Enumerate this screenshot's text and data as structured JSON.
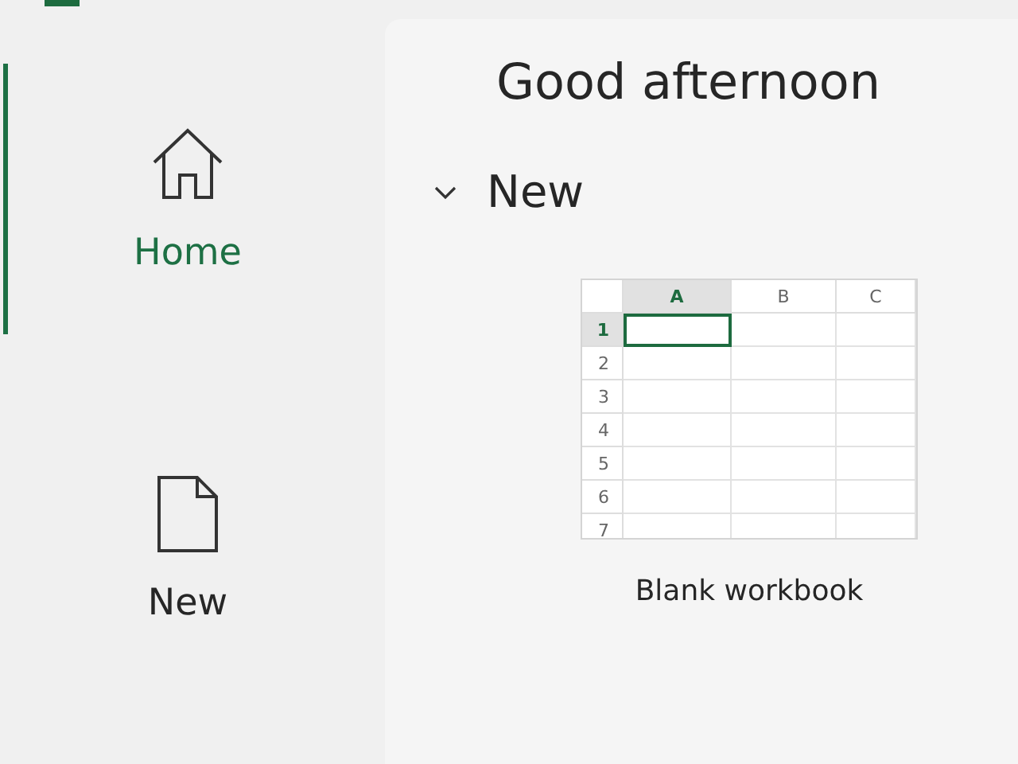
{
  "nav": [
    {
      "label": "Home",
      "kind": "home",
      "selected": true
    },
    {
      "label": "New",
      "kind": "new",
      "selected": false
    }
  ],
  "greeting": "Good afternoon",
  "section": {
    "title": "New",
    "expanded": true
  },
  "templates": [
    {
      "label": "Blank workbook",
      "columns": [
        "A",
        "B",
        "C"
      ],
      "rows": [
        "1",
        "2",
        "3",
        "4",
        "5",
        "6",
        "7"
      ]
    }
  ]
}
